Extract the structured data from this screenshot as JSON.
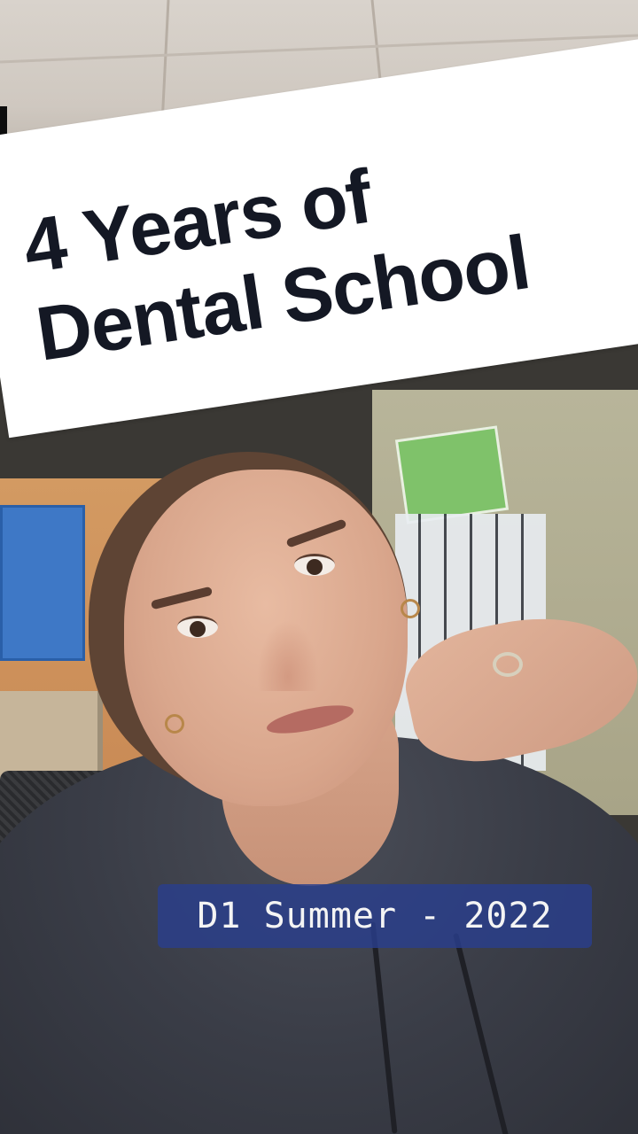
{
  "title_overlay": {
    "line1": "4 Years of",
    "line2": "Dental School"
  },
  "caption": {
    "text": "D1 Summer - 2022"
  },
  "colors": {
    "title_card_bg": "#ffffff",
    "title_text": "#141824",
    "caption_bg": "#2a3e8c",
    "caption_text": "#f4f4f4",
    "hoodie_print": "#e3a62a"
  }
}
